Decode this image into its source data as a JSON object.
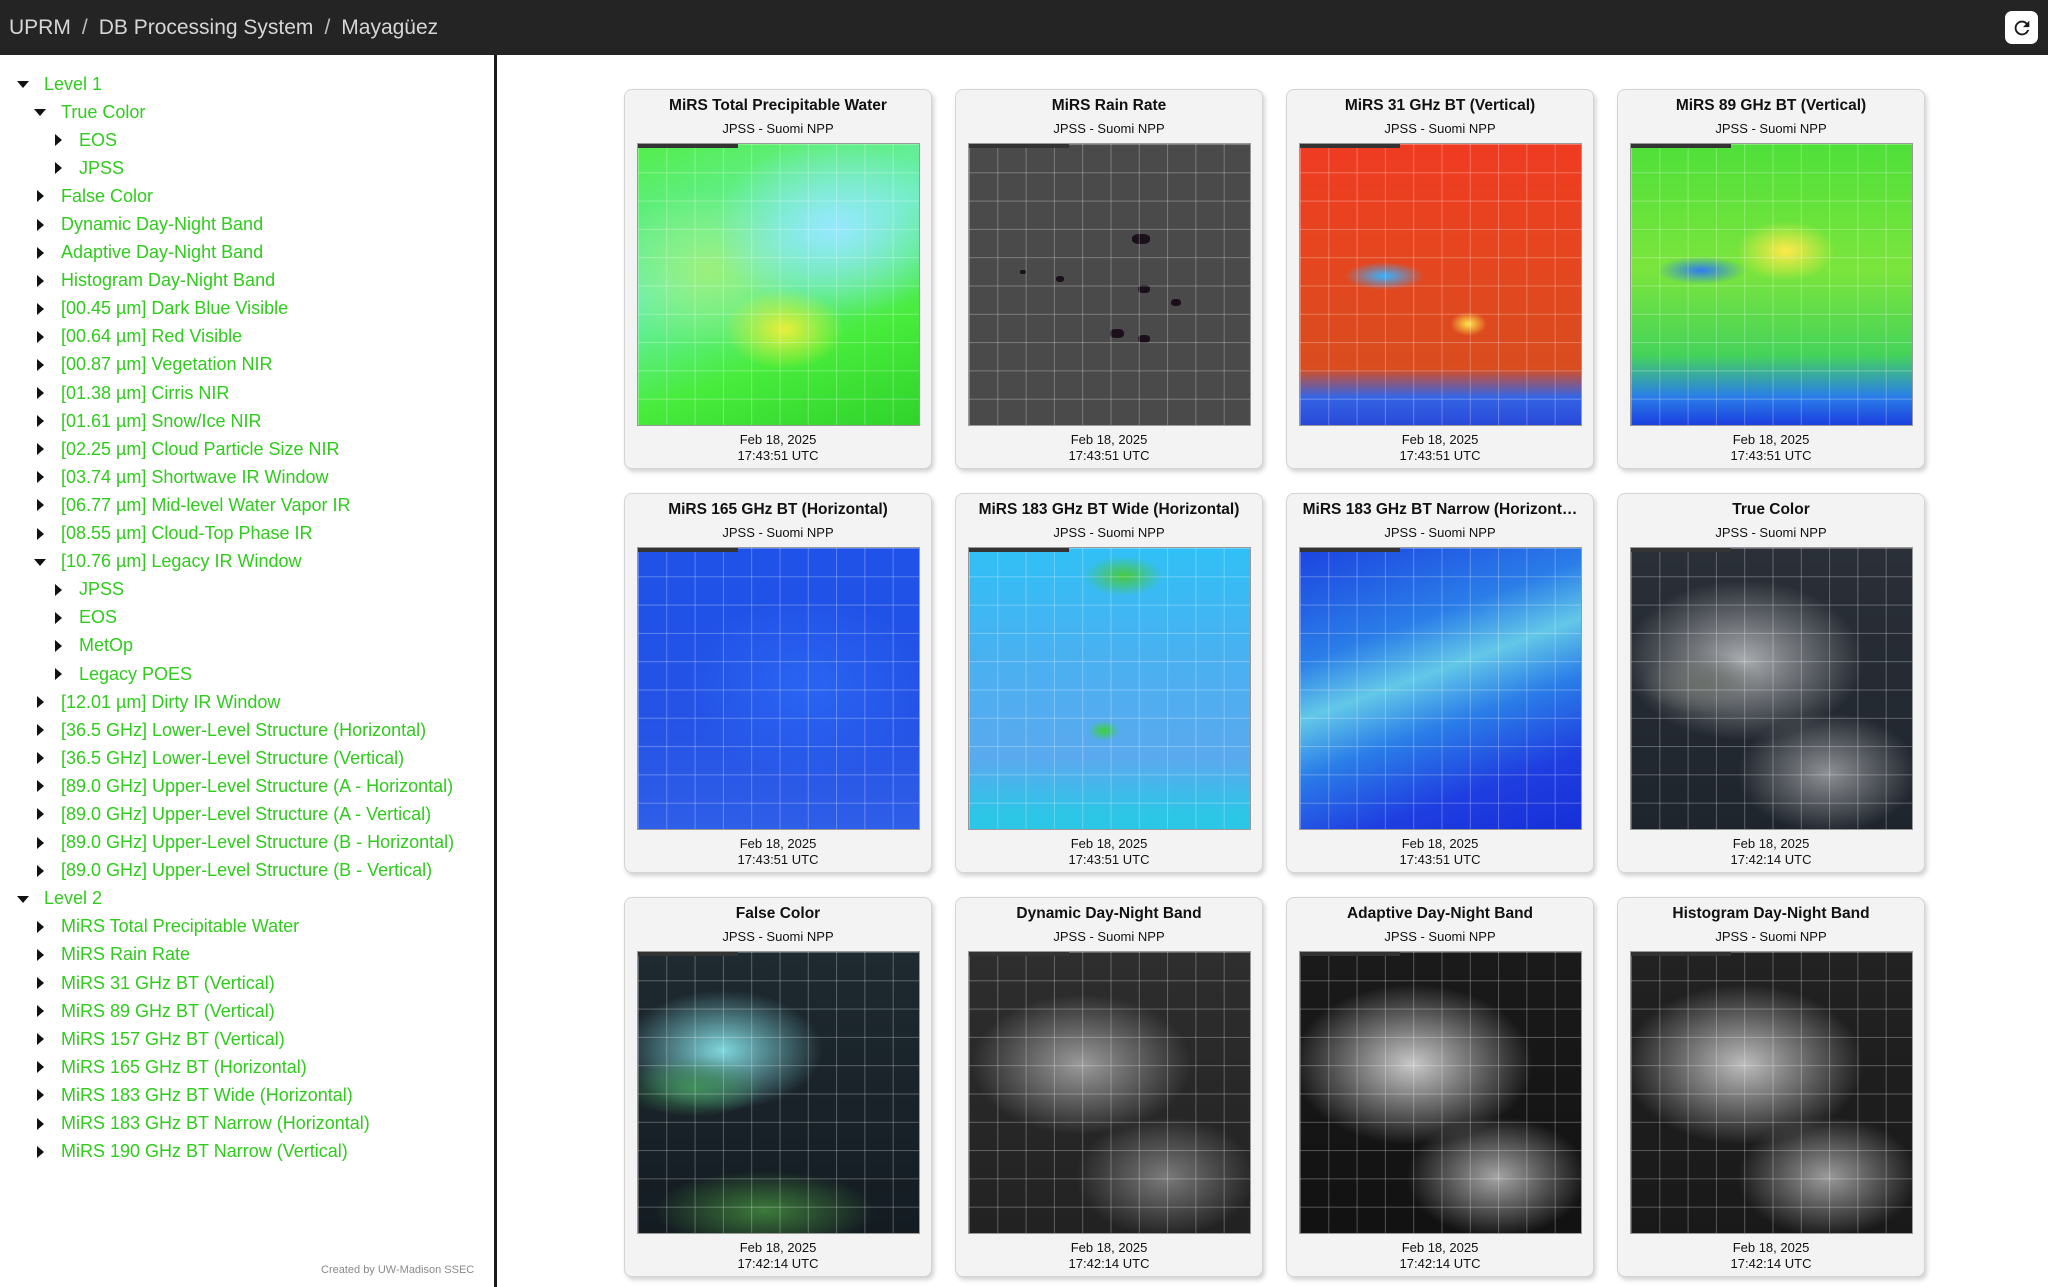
{
  "header": {
    "breadcrumb": [
      "UPRM",
      "DB Processing System",
      "Mayagüez"
    ],
    "separator": "/",
    "refresh_icon": "refresh-icon"
  },
  "sidebar": {
    "colors": {
      "link": "#2ecc1b",
      "border": "#1a1a1a"
    },
    "tree": [
      {
        "label": "Level 1",
        "level": 0,
        "expanded": true
      },
      {
        "label": "True Color",
        "level": 1,
        "expanded": true
      },
      {
        "label": "EOS",
        "level": 2,
        "expanded": false
      },
      {
        "label": "JPSS",
        "level": 2,
        "expanded": false
      },
      {
        "label": "False Color",
        "level": 1,
        "expanded": false
      },
      {
        "label": "Dynamic Day-Night Band",
        "level": 1,
        "expanded": false
      },
      {
        "label": "Adaptive Day-Night Band",
        "level": 1,
        "expanded": false
      },
      {
        "label": "Histogram Day-Night Band",
        "level": 1,
        "expanded": false
      },
      {
        "label": "[00.45 µm] Dark Blue Visible",
        "level": 1,
        "expanded": false
      },
      {
        "label": "[00.64 µm] Red Visible",
        "level": 1,
        "expanded": false
      },
      {
        "label": "[00.87 µm] Vegetation NIR",
        "level": 1,
        "expanded": false
      },
      {
        "label": "[01.38 µm] Cirris NIR",
        "level": 1,
        "expanded": false
      },
      {
        "label": "[01.61 µm] Snow/Ice NIR",
        "level": 1,
        "expanded": false
      },
      {
        "label": "[02.25 µm] Cloud Particle Size NIR",
        "level": 1,
        "expanded": false
      },
      {
        "label": "[03.74 µm] Shortwave IR Window",
        "level": 1,
        "expanded": false
      },
      {
        "label": "[06.77 µm] Mid-level Water Vapor IR",
        "level": 1,
        "expanded": false
      },
      {
        "label": "[08.55 µm] Cloud-Top Phase IR",
        "level": 1,
        "expanded": false
      },
      {
        "label": "[10.76 µm] Legacy IR Window",
        "level": 1,
        "expanded": true
      },
      {
        "label": "JPSS",
        "level": 2,
        "expanded": false
      },
      {
        "label": "EOS",
        "level": 2,
        "expanded": false
      },
      {
        "label": "MetOp",
        "level": 2,
        "expanded": false
      },
      {
        "label": "Legacy POES",
        "level": 2,
        "expanded": false
      },
      {
        "label": "[12.01 µm] Dirty IR Window",
        "level": 1,
        "expanded": false
      },
      {
        "label": "[36.5 GHz] Lower-Level Structure (Horizontal)",
        "level": 1,
        "expanded": false
      },
      {
        "label": "[36.5 GHz] Lower-Level Structure (Vertical)",
        "level": 1,
        "expanded": false
      },
      {
        "label": "[89.0 GHz] Upper-Level Structure (A - Horizontal)",
        "level": 1,
        "expanded": false
      },
      {
        "label": "[89.0 GHz] Upper-Level Structure (A - Vertical)",
        "level": 1,
        "expanded": false
      },
      {
        "label": "[89.0 GHz] Upper-Level Structure (B - Horizontal)",
        "level": 1,
        "expanded": false
      },
      {
        "label": "[89.0 GHz] Upper-Level Structure (B - Vertical)",
        "level": 1,
        "expanded": false
      },
      {
        "label": "Level 2",
        "level": 0,
        "expanded": true
      },
      {
        "label": "MiRS Total Precipitable Water",
        "level": 1,
        "expanded": false
      },
      {
        "label": "MiRS Rain Rate",
        "level": 1,
        "expanded": false
      },
      {
        "label": "MiRS 31 GHz BT (Vertical)",
        "level": 1,
        "expanded": false
      },
      {
        "label": "MiRS 89 GHz BT (Vertical)",
        "level": 1,
        "expanded": false
      },
      {
        "label": "MiRS 157 GHz BT (Vertical)",
        "level": 1,
        "expanded": false
      },
      {
        "label": "MiRS 165 GHz BT (Horizontal)",
        "level": 1,
        "expanded": false
      },
      {
        "label": "MiRS 183 GHz BT Wide (Horizontal)",
        "level": 1,
        "expanded": false
      },
      {
        "label": "MiRS 183 GHz BT Narrow (Horizontal)",
        "level": 1,
        "expanded": false
      },
      {
        "label": "MiRS 190 GHz BT Narrow (Vertical)",
        "level": 1,
        "expanded": false
      }
    ],
    "credit": "Created by UW-Madison SSEC"
  },
  "cards": [
    {
      "title": "MiRS Total Precipitable Water",
      "subtitle": "JPSS - Suomi NPP",
      "date": "Feb 18, 2025",
      "time": "17:43:51 UTC",
      "image": "tpw"
    },
    {
      "title": "MiRS Rain Rate",
      "subtitle": "JPSS - Suomi NPP",
      "date": "Feb 18, 2025",
      "time": "17:43:51 UTC",
      "image": "rain"
    },
    {
      "title": "MiRS 31 GHz BT (Vertical)",
      "subtitle": "JPSS - Suomi NPP",
      "date": "Feb 18, 2025",
      "time": "17:43:51 UTC",
      "image": "31"
    },
    {
      "title": "MiRS 89 GHz BT (Vertical)",
      "subtitle": "JPSS - Suomi NPP",
      "date": "Feb 18, 2025",
      "time": "17:43:51 UTC",
      "image": "89"
    },
    {
      "title": "MiRS 165 GHz BT (Horizontal)",
      "subtitle": "JPSS - Suomi NPP",
      "date": "Feb 18, 2025",
      "time": "17:43:51 UTC",
      "image": "165"
    },
    {
      "title": "MiRS 183 GHz BT Wide (Horizontal)",
      "subtitle": "JPSS - Suomi NPP",
      "date": "Feb 18, 2025",
      "time": "17:43:51 UTC",
      "image": "183w"
    },
    {
      "title": "MiRS 183 GHz BT Narrow (Horizont…",
      "subtitle": "JPSS - Suomi NPP",
      "date": "Feb 18, 2025",
      "time": "17:43:51 UTC",
      "image": "183n"
    },
    {
      "title": "True Color",
      "subtitle": "JPSS - Suomi NPP",
      "date": "Feb 18, 2025",
      "time": "17:42:14 UTC",
      "image": "tc"
    },
    {
      "title": "False Color",
      "subtitle": "JPSS - Suomi NPP",
      "date": "Feb 18, 2025",
      "time": "17:42:14 UTC",
      "image": "fc"
    },
    {
      "title": "Dynamic Day-Night Band",
      "subtitle": "JPSS - Suomi NPP",
      "date": "Feb 18, 2025",
      "time": "17:42:14 UTC",
      "image": "dnb"
    },
    {
      "title": "Adaptive Day-Night Band",
      "subtitle": "JPSS - Suomi NPP",
      "date": "Feb 18, 2025",
      "time": "17:42:14 UTC",
      "image": "adnb"
    },
    {
      "title": "Histogram Day-Night Band",
      "subtitle": "JPSS - Suomi NPP",
      "date": "Feb 18, 2025",
      "time": "17:42:14 UTC",
      "image": "hdnb"
    }
  ]
}
